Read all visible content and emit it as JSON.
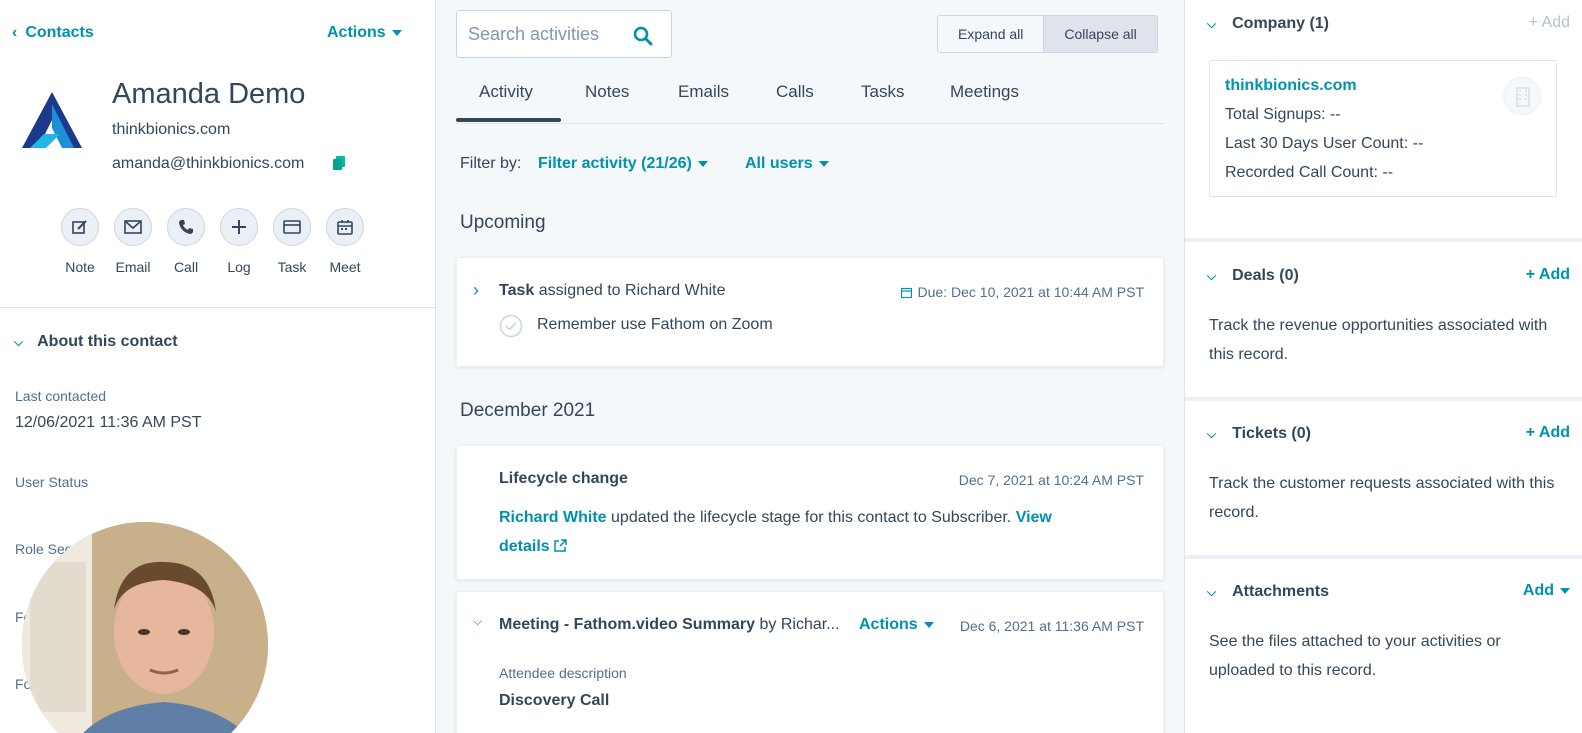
{
  "left": {
    "back_label": "Contacts",
    "actions_label": "Actions",
    "contact": {
      "name": "Amanda Demo",
      "domain": "thinkbionics.com",
      "email": "amanda@thinkbionics.com"
    },
    "quick_actions": [
      {
        "label": "Note",
        "icon": "note-icon"
      },
      {
        "label": "Email",
        "icon": "email-icon"
      },
      {
        "label": "Call",
        "icon": "call-icon"
      },
      {
        "label": "Log",
        "icon": "log-icon"
      },
      {
        "label": "Task",
        "icon": "task-icon"
      },
      {
        "label": "Meet",
        "icon": "meet-icon"
      }
    ],
    "about_title": "About this contact",
    "properties": [
      {
        "label": "Last contacted",
        "value": "12/06/2021 11:36 AM PST"
      },
      {
        "label": "User Status",
        "value": ""
      },
      {
        "label": "Role Seg",
        "value": ""
      },
      {
        "label": "Fo",
        "value": ""
      },
      {
        "label": "Fo",
        "value": ""
      }
    ]
  },
  "middle": {
    "search_placeholder": "Search activities",
    "expand_all": "Expand all",
    "collapse_all": "Collapse all",
    "tabs": [
      {
        "label": "Activity",
        "active": true
      },
      {
        "label": "Notes"
      },
      {
        "label": "Emails"
      },
      {
        "label": "Calls"
      },
      {
        "label": "Tasks"
      },
      {
        "label": "Meetings"
      }
    ],
    "filter": {
      "label": "Filter by:",
      "activity": "Filter activity (21/26)",
      "users": "All users"
    },
    "upcoming_heading": "Upcoming",
    "task_card": {
      "type": "Task",
      "assigned_text": "assigned to Richard White",
      "due": "Due: Dec 10, 2021 at 10:44 AM PST",
      "subject": "Remember use Fathom on Zoom"
    },
    "month_heading": "December 2021",
    "lifecycle_card": {
      "title": "Lifecycle change",
      "date": "Dec 7, 2021 at 10:24 AM PST",
      "actor": "Richard White",
      "text": "updated the lifecycle stage for this contact to Subscriber.",
      "link_part1": "View",
      "link_part2": "details"
    },
    "meeting_card": {
      "title": "Meeting - Fathom.video Summary",
      "by": "by Richar...",
      "actions": "Actions",
      "date": "Dec 6, 2021 at 11:36 AM PST",
      "attendee_label": "Attendee description",
      "attendee_value": "Discovery Call"
    }
  },
  "right": {
    "company": {
      "title": "Company (1)",
      "add": "+ Add",
      "name": "thinkbionics.com",
      "lines": [
        "Total Signups: --",
        "Last 30 Days User Count: --",
        "Recorded Call Count: --"
      ]
    },
    "deals": {
      "title": "Deals (0)",
      "add": "+ Add",
      "desc": "Track the revenue opportunities associated with this record."
    },
    "tickets": {
      "title": "Tickets (0)",
      "add": "+ Add",
      "desc": "Track the customer requests associated with this record."
    },
    "attachments": {
      "title": "Attachments",
      "add": "Add",
      "desc": "See the files attached to your activities or uploaded to this record."
    }
  },
  "colors": {
    "accent": "#0091ae",
    "text": "#33475b",
    "border": "#dfe3eb"
  }
}
